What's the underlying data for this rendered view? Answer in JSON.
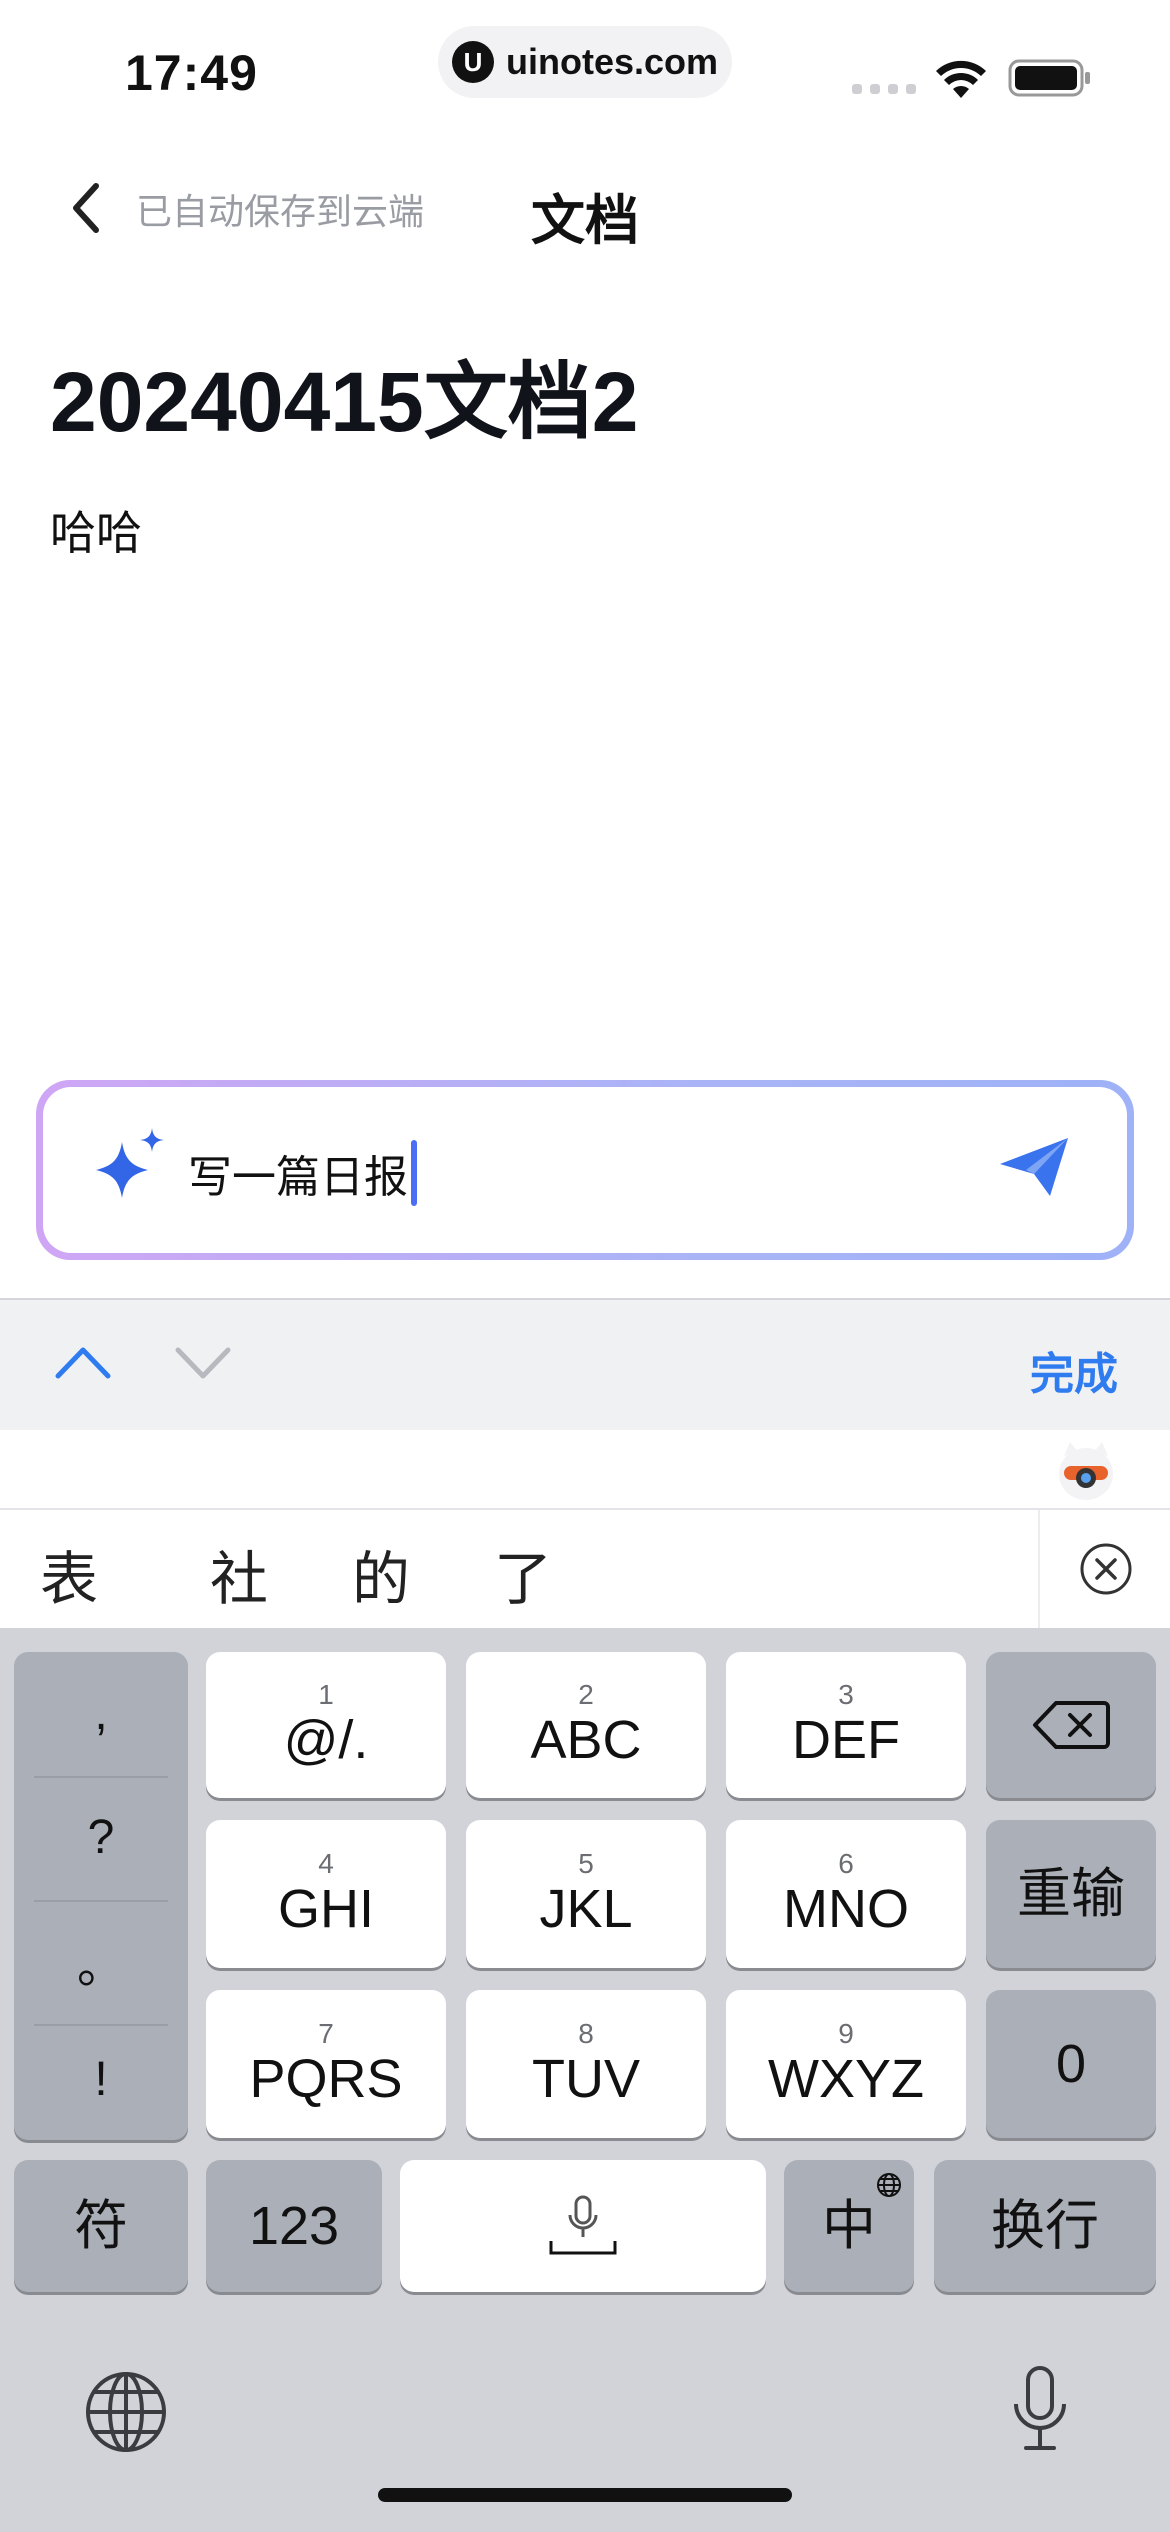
{
  "status": {
    "time": "17:49",
    "url": "uinotes.com",
    "url_logo_letter": "U"
  },
  "nav": {
    "saved_status": "已自动保存到云端",
    "title": "文档"
  },
  "document": {
    "title": "20240415文档2",
    "body": "哈哈"
  },
  "ai_input": {
    "value": "写一篇日报",
    "spark_icon": "sparkle-icon",
    "send_icon": "send-icon"
  },
  "accessory": {
    "done": "完成"
  },
  "candidates": [
    "表",
    "社",
    "的",
    "了"
  ],
  "keyboard": {
    "punct": [
      ",",
      "?",
      "。",
      "!"
    ],
    "rows": [
      [
        {
          "num": "1",
          "label": "@/."
        },
        {
          "num": "2",
          "label": "ABC"
        },
        {
          "num": "3",
          "label": "DEF"
        }
      ],
      [
        {
          "num": "4",
          "label": "GHI"
        },
        {
          "num": "5",
          "label": "JKL"
        },
        {
          "num": "6",
          "label": "MNO"
        }
      ],
      [
        {
          "num": "7",
          "label": "PQRS"
        },
        {
          "num": "8",
          "label": "TUV"
        },
        {
          "num": "9",
          "label": "WXYZ"
        }
      ]
    ],
    "reenter": "重输",
    "zero": "0",
    "symbols": "符",
    "numbers": "123",
    "lang": "中",
    "return": "换行"
  },
  "colors": {
    "accent": "#2f7bf0",
    "caret": "#4c6ef5",
    "keyboard_bg": "#d1d3d9"
  }
}
